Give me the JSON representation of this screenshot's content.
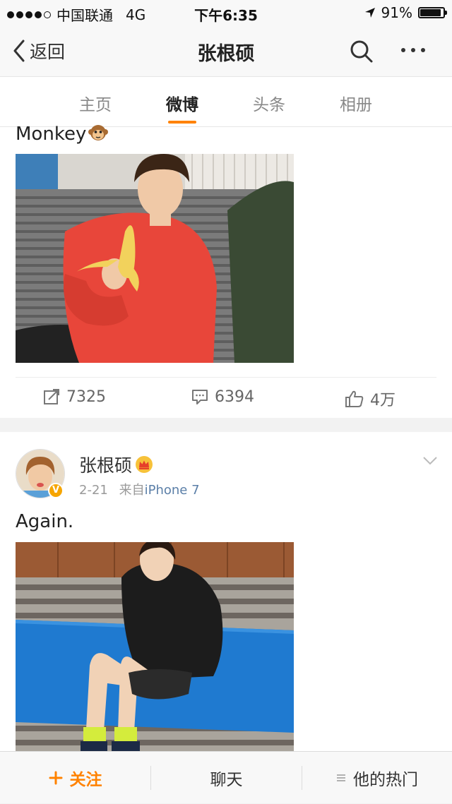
{
  "status_bar": {
    "carrier": "中国联通",
    "network": "4G",
    "time": "下午6:35",
    "battery": "91%",
    "battery_level": 0.91,
    "signal_strength": 4,
    "icons": [
      "location-arrow-icon",
      "battery-icon"
    ]
  },
  "nav": {
    "back_label": "返回",
    "title": "张根硕",
    "icons": [
      "back-chevron-icon",
      "search-icon",
      "more-icon"
    ]
  },
  "tabs": [
    {
      "label": "主页",
      "active": false
    },
    {
      "label": "微博",
      "active": true
    },
    {
      "label": "头条",
      "active": false
    },
    {
      "label": "相册",
      "active": false
    }
  ],
  "posts": [
    {
      "text": "Monkey",
      "emoji": "monkey-face-icon",
      "image": "photo-man-eating-banana",
      "actions": {
        "repost_count": "7325",
        "comment_count": "6394",
        "like_count": "4万"
      }
    },
    {
      "author": "张根硕",
      "badge": "crown-icon",
      "verified": true,
      "date": "2-21",
      "source_prefix": "来自",
      "source": "iPhone 7",
      "text": "Again.",
      "image": "photo-man-sitting-on-mat"
    }
  ],
  "bottom_bar": {
    "follow_label": "关注",
    "chat_label": "聊天",
    "hot_label": "他的热门"
  },
  "colors": {
    "accent": "#ff8200",
    "link": "#5b7fa8",
    "verified": "#f6a500"
  }
}
